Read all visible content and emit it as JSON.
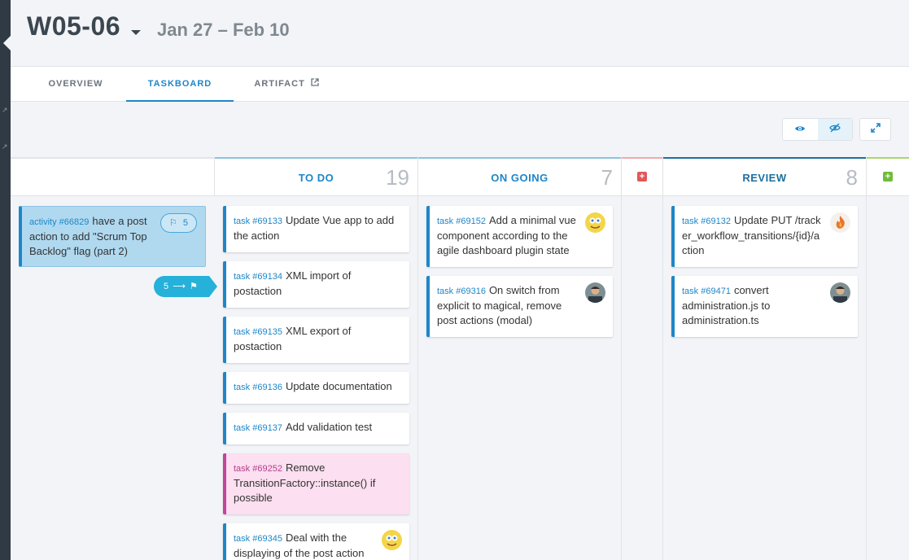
{
  "header": {
    "title": "W05-06",
    "dates": "Jan 27 – Feb 10"
  },
  "tabs": [
    {
      "label": "OVERVIEW"
    },
    {
      "label": "TASKBOARD"
    },
    {
      "label": "ARTIFACT"
    }
  ],
  "toolbar": {
    "show_icon": "eye-icon",
    "hide_icon": "eye-slash-icon",
    "fullscreen_icon": "expand-icon"
  },
  "swimlane": {
    "activity_ref": "activity #66829",
    "activity_title": "have a post action to add \"Scrum Top Backlog\" flag (part 2)",
    "effort": "5",
    "remaining": "5"
  },
  "columns": {
    "todo": {
      "name": "TO DO",
      "count": "19",
      "color": "#8cc3e3"
    },
    "ongoing": {
      "name": "ON GOING",
      "count": "7",
      "color": "#8cc3e3"
    },
    "blocked": {
      "color": "#f2a8a8",
      "plus_color": "#e15858"
    },
    "review": {
      "name": "REVIEW",
      "count": "8",
      "color": "#1d6f9e"
    },
    "done": {
      "color": "#a9d66e",
      "plus_color": "#6fbd3a"
    }
  },
  "cards": {
    "todo": [
      {
        "ref": "task #69133",
        "title": "Update Vue app to add the action"
      },
      {
        "ref": "task #69134",
        "title": "XML import of postaction"
      },
      {
        "ref": "task #69135",
        "title": "XML export of postaction"
      },
      {
        "ref": "task #69136",
        "title": "Update documentation"
      },
      {
        "ref": "task #69137",
        "title": "Add validation test"
      },
      {
        "ref": "task #69252",
        "title": "Remove TransitionFactory::instance() if possible"
      },
      {
        "ref": "task #69345",
        "title": "Deal with the displaying of the post action"
      }
    ],
    "ongoing": [
      {
        "ref": "task #69152",
        "title": "Add a minimal vue component according to the agile dashboard plugin state"
      },
      {
        "ref": "task #69316",
        "title": "On switch from explicit to magical, remove post actions (modal)"
      }
    ],
    "review": [
      {
        "ref": "task #69132",
        "title": "Update PUT /tracker_workflow_transitions/{id}/action"
      },
      {
        "ref": "task #69471",
        "title": "convert administration.js to administration.ts"
      }
    ]
  },
  "colors": {
    "accent": "#1e86c8",
    "rail": "#2f3a44",
    "pink_card": "#fcdff0",
    "activity_card": "#b0d9f0",
    "badge": "#25b1d9"
  }
}
